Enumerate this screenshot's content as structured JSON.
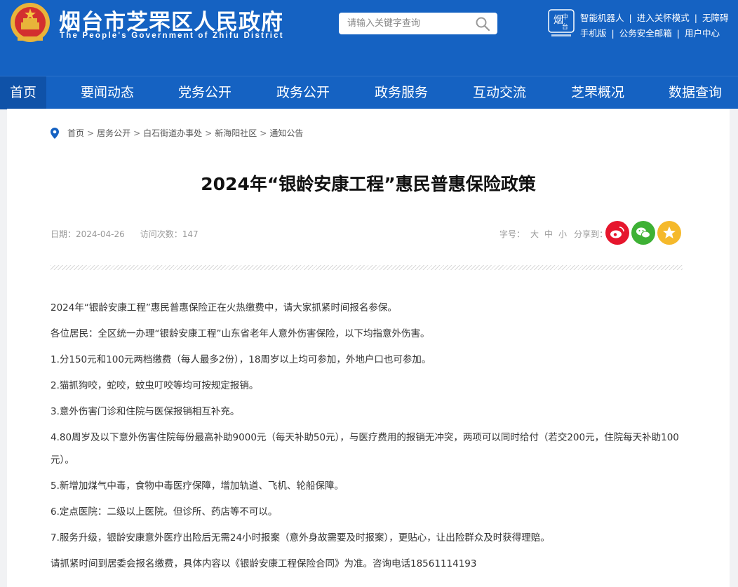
{
  "header": {
    "title": "烟台市芝罘区人民政府",
    "subtitle": "The People's Government of Zhifu District",
    "search_placeholder": "请输入关键字查询",
    "top_links_row1": [
      "智能机器人",
      "进入关怀模式",
      "无障碍"
    ],
    "top_links_row2": [
      "手机版",
      "公务安全邮箱",
      "用户中心"
    ],
    "icons": [
      "national-emblem",
      "search-icon",
      "yantai-china-logo"
    ],
    "colors": {
      "brand_blue": "#1562c2",
      "nav_active": "#0f52a8"
    }
  },
  "nav": {
    "items": [
      "首页",
      "要闻动态",
      "党务公开",
      "政务公开",
      "政务服务",
      "互动交流",
      "芝罘概况",
      "数据查询"
    ],
    "active_index": 0
  },
  "breadcrumb": [
    "首页",
    "居务公开",
    "白石街道办事处",
    "新海阳社区",
    "通知公告"
  ],
  "article": {
    "title": "2024年“银龄安康工程”惠民普惠保险政策",
    "date_label": "日期：",
    "date": "2024-04-26",
    "visits_label": "访问次数：",
    "visits": "147",
    "font_size_label": "字号：",
    "font_sizes": [
      "大",
      "中",
      "小"
    ],
    "share_label": "分享到：",
    "share_icons": [
      "weibo-icon",
      "wechat-icon",
      "favorite-icon"
    ],
    "share_colors": {
      "weibo": "#e6162d",
      "wechat": "#3eb135",
      "favorite": "#f5b92b"
    },
    "paragraphs": [
      "2024年“银龄安康工程”惠民普惠保险正在火热缴费中，请大家抓紧时间报名参保。",
      "各位居民：全区统一办理“银龄安康工程”山东省老年人意外伤害保险，以下均指意外伤害。",
      "1.分150元和100元两档缴费（每人最多2份），18周岁以上均可参加，外地户口也可参加。",
      "2.猫抓狗咬，蛇咬，蚊虫叮咬等均可按规定报销。",
      "3.意外伤害门诊和住院与医保报销相互补充。",
      "4.80周岁及以下意外伤害住院每份最高补助9000元（每天补助50元），与医疗费用的报销无冲突，两项可以同时给付（若交200元，住院每天补助100元）。",
      "5.新增加煤气中毒，食物中毒医疗保障，增加轨道、飞机、轮船保障。",
      "6.定点医院：二级以上医院。但诊所、药店等不可以。",
      "7.服务升级，银龄安康意外医疗出险后无需24小时报案（意外身故需要及时报案），更贴心，让出险群众及时获得理赔。",
      "请抓紧时间到居委会报名缴费，具体内容以《银龄安康工程保险合同》为准。咨询电话18561114193"
    ]
  }
}
